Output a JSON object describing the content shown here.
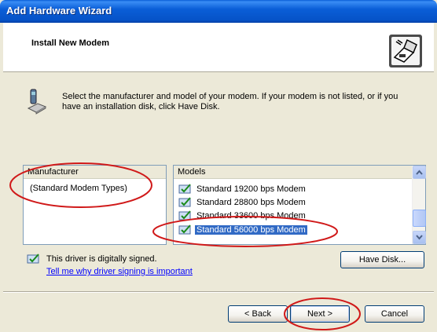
{
  "window": {
    "title": "Add Hardware Wizard"
  },
  "header": {
    "heading": "Install New Modem"
  },
  "instruction": "Select the manufacturer and model of your modem. If your modem is not listed, or if you have an installation disk, click Have Disk.",
  "manufacturer": {
    "header": "Manufacturer",
    "items": [
      "(Standard Modem Types)"
    ]
  },
  "models": {
    "header": "Models",
    "items": [
      "Standard 19200 bps Modem",
      "Standard 28800 bps Modem",
      "Standard 33600 bps Modem",
      "Standard 56000 bps Modem"
    ],
    "selected": "Standard 56000 bps Modem"
  },
  "driver": {
    "signed_text": "This driver is digitally signed.",
    "signing_link": "Tell me why driver signing is important"
  },
  "buttons": {
    "have_disk": "Have Disk...",
    "back": "< Back",
    "next": "Next >",
    "cancel": "Cancel"
  },
  "colors": {
    "titlebar": "#0a5ed7",
    "selection": "#316ac5",
    "annotation": "#d01919",
    "link": "#0000ff"
  }
}
